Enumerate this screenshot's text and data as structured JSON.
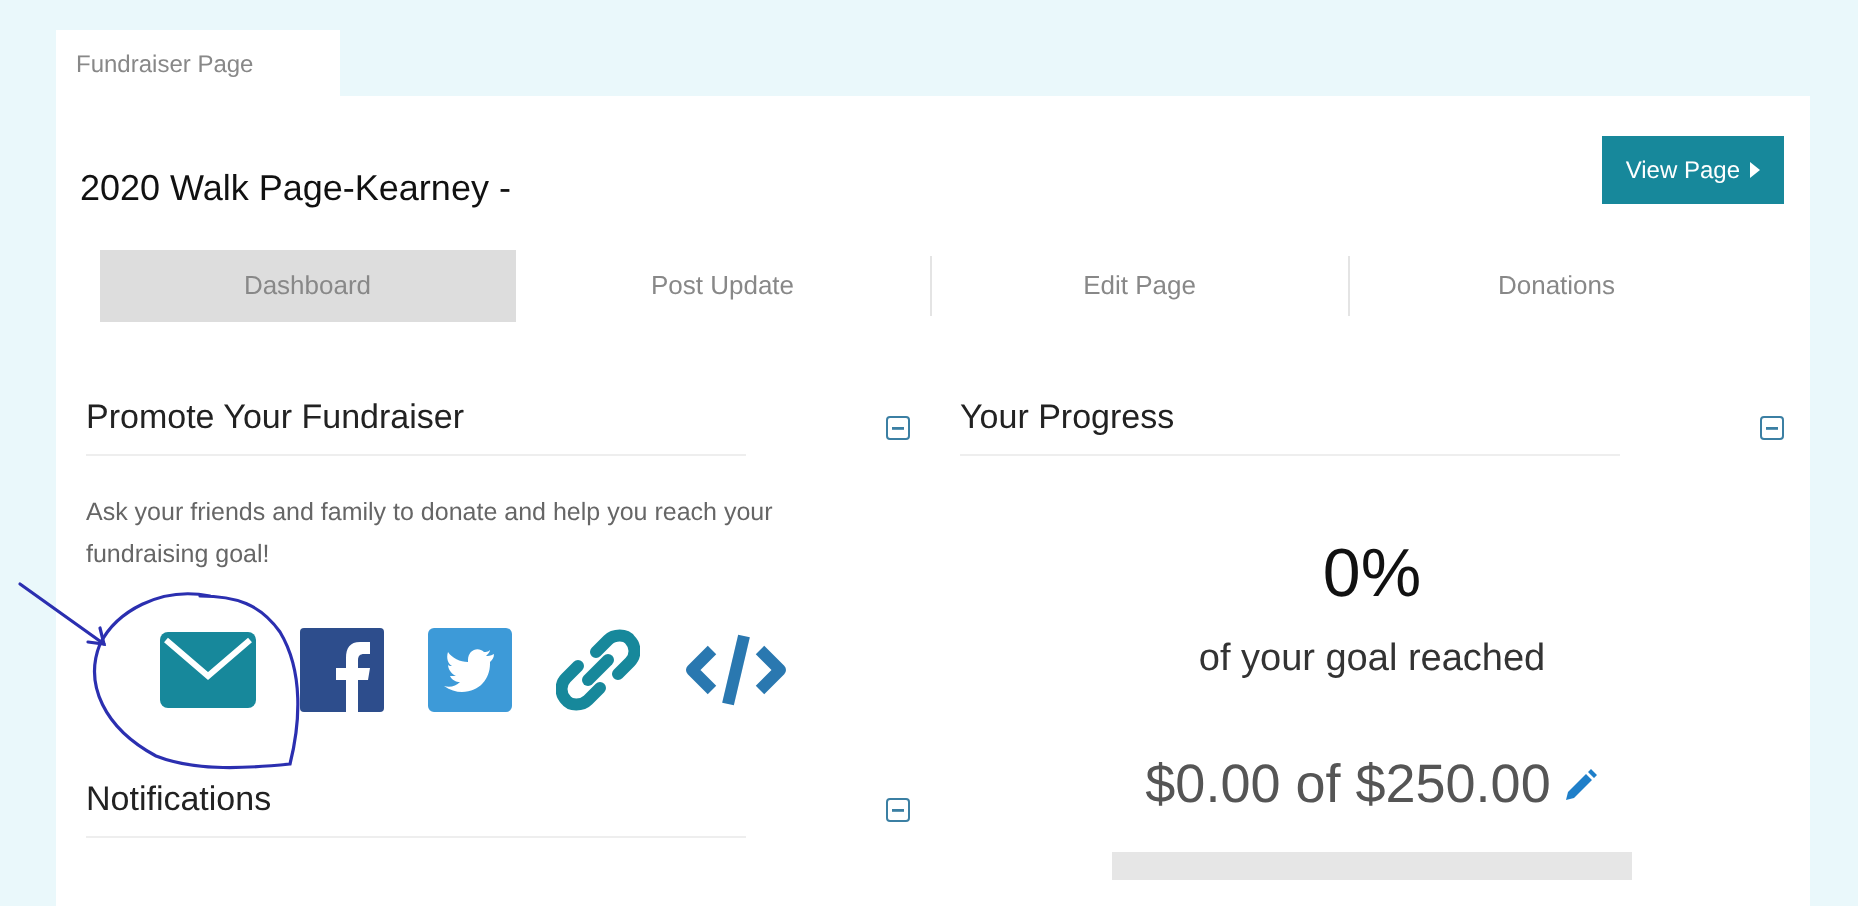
{
  "page_tab": {
    "label": "Fundraiser Page"
  },
  "page_title": "2020 Walk Page-Kearney -",
  "view_button": {
    "label": "View Page"
  },
  "nav_tabs": [
    {
      "label": "Dashboard",
      "selected": true
    },
    {
      "label": "Post Update",
      "selected": false
    },
    {
      "label": "Edit Page",
      "selected": false
    },
    {
      "label": "Donations",
      "selected": false
    }
  ],
  "promote": {
    "title": "Promote Your Fundraiser",
    "description": "Ask your friends and family to donate and help you reach your fundraising goal!",
    "share_icons": [
      {
        "kind": "email"
      },
      {
        "kind": "facebook"
      },
      {
        "kind": "twitter"
      },
      {
        "kind": "link"
      },
      {
        "kind": "embed"
      }
    ]
  },
  "notifications": {
    "title": "Notifications"
  },
  "progress": {
    "title": "Your Progress",
    "percent": "0%",
    "caption": "of your goal reached",
    "amount": "$0.00 of $250.00"
  }
}
